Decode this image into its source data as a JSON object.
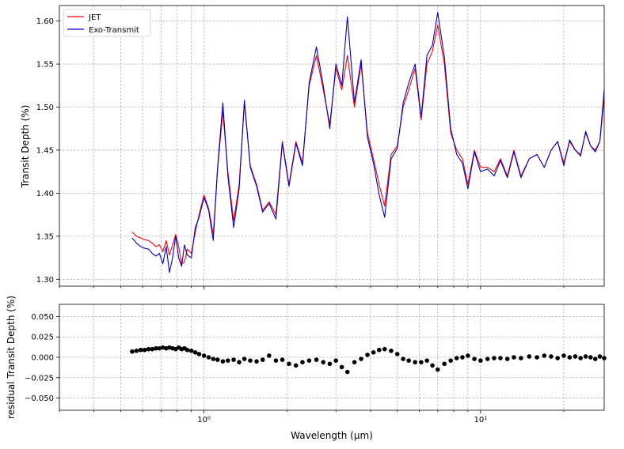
{
  "chart_data": [
    {
      "type": "line",
      "title": "",
      "xlabel": "",
      "ylabel": "Transit Depth (%)",
      "x_scale": "log",
      "xlim": [
        0.3,
        28
      ],
      "ylim": [
        1.292,
        1.618
      ],
      "yticks": [
        1.3,
        1.35,
        1.4,
        1.45,
        1.5,
        1.55,
        1.6
      ],
      "ytick_labels": [
        "1.30",
        "1.35",
        "1.40",
        "1.45",
        "1.50",
        "1.55",
        "1.60"
      ],
      "grid": true,
      "legend_position": "top-left",
      "colors": {
        "JET": "#ff0000",
        "Exo-Transmit": "#0000cc"
      },
      "x": [
        0.55,
        0.57,
        0.59,
        0.61,
        0.63,
        0.65,
        0.67,
        0.69,
        0.71,
        0.73,
        0.75,
        0.77,
        0.79,
        0.81,
        0.83,
        0.85,
        0.87,
        0.9,
        0.93,
        0.96,
        1.0,
        1.04,
        1.08,
        1.12,
        1.17,
        1.22,
        1.28,
        1.34,
        1.4,
        1.47,
        1.55,
        1.63,
        1.72,
        1.82,
        1.92,
        2.03,
        2.15,
        2.27,
        2.4,
        2.55,
        2.7,
        2.85,
        3.0,
        3.15,
        3.3,
        3.5,
        3.7,
        3.9,
        4.1,
        4.3,
        4.5,
        4.75,
        5.0,
        5.25,
        5.5,
        5.8,
        6.1,
        6.4,
        6.7,
        7.0,
        7.4,
        7.8,
        8.2,
        8.6,
        9.0,
        9.5,
        10.0,
        10.6,
        11.2,
        11.8,
        12.5,
        13.2,
        14.0,
        15.0,
        16.0,
        17.0,
        18.0,
        19.0,
        20.0,
        21.0,
        22.0,
        23.0,
        24.0,
        25.0,
        26.0,
        27.0,
        28.0
      ],
      "series": [
        {
          "name": "JET",
          "values": [
            1.355,
            1.35,
            1.348,
            1.346,
            1.345,
            1.342,
            1.338,
            1.34,
            1.332,
            1.345,
            1.328,
            1.34,
            1.352,
            1.338,
            1.318,
            1.32,
            1.335,
            1.33,
            1.355,
            1.375,
            1.398,
            1.382,
            1.352,
            1.428,
            1.495,
            1.425,
            1.368,
            1.41,
            1.505,
            1.432,
            1.41,
            1.38,
            1.39,
            1.375,
            1.46,
            1.41,
            1.46,
            1.435,
            1.525,
            1.56,
            1.52,
            1.48,
            1.545,
            1.52,
            1.56,
            1.5,
            1.55,
            1.47,
            1.44,
            1.41,
            1.385,
            1.445,
            1.455,
            1.5,
            1.52,
            1.545,
            1.485,
            1.55,
            1.565,
            1.595,
            1.55,
            1.47,
            1.45,
            1.44,
            1.41,
            1.45,
            1.43,
            1.43,
            1.425,
            1.44,
            1.42,
            1.45,
            1.42,
            1.44,
            1.445,
            1.43,
            1.45,
            1.46,
            1.435,
            1.46,
            1.45,
            1.445,
            1.47,
            1.455,
            1.45,
            1.46,
            1.51
          ]
        },
        {
          "name": "Exo-Transmit",
          "values": [
            1.348,
            1.342,
            1.338,
            1.336,
            1.335,
            1.33,
            1.327,
            1.33,
            1.318,
            1.338,
            1.308,
            1.325,
            1.35,
            1.325,
            1.315,
            1.34,
            1.328,
            1.325,
            1.36,
            1.372,
            1.395,
            1.38,
            1.345,
            1.43,
            1.505,
            1.42,
            1.36,
            1.405,
            1.508,
            1.43,
            1.408,
            1.378,
            1.388,
            1.37,
            1.458,
            1.408,
            1.458,
            1.432,
            1.528,
            1.57,
            1.525,
            1.475,
            1.55,
            1.525,
            1.605,
            1.505,
            1.555,
            1.465,
            1.435,
            1.398,
            1.372,
            1.44,
            1.452,
            1.505,
            1.528,
            1.55,
            1.488,
            1.56,
            1.572,
            1.61,
            1.558,
            1.475,
            1.445,
            1.435,
            1.405,
            1.448,
            1.425,
            1.428,
            1.42,
            1.438,
            1.418,
            1.448,
            1.418,
            1.44,
            1.445,
            1.43,
            1.45,
            1.46,
            1.432,
            1.462,
            1.45,
            1.443,
            1.472,
            1.455,
            1.448,
            1.46,
            1.52
          ]
        }
      ]
    },
    {
      "type": "scatter",
      "title": "",
      "xlabel": "Wavelength (μm)",
      "ylabel": "residual Transit Depth (%)",
      "x_scale": "log",
      "xlim": [
        0.3,
        28
      ],
      "ylim": [
        -0.065,
        0.065
      ],
      "yticks": [
        -0.05,
        -0.025,
        0.0,
        0.025,
        0.05
      ],
      "ytick_labels": [
        "−0.050",
        "−0.025",
        "0.000",
        "0.025",
        "0.050"
      ],
      "xticks": [
        1,
        10
      ],
      "xtick_labels": [
        "10⁰",
        "10¹"
      ],
      "grid": true,
      "colors": {
        "markers": "#000000"
      },
      "x": [
        0.55,
        0.57,
        0.59,
        0.61,
        0.63,
        0.65,
        0.67,
        0.69,
        0.71,
        0.73,
        0.75,
        0.77,
        0.79,
        0.81,
        0.83,
        0.85,
        0.87,
        0.9,
        0.93,
        0.96,
        1.0,
        1.04,
        1.08,
        1.12,
        1.17,
        1.22,
        1.28,
        1.34,
        1.4,
        1.47,
        1.55,
        1.63,
        1.72,
        1.82,
        1.92,
        2.03,
        2.15,
        2.27,
        2.4,
        2.55,
        2.7,
        2.85,
        3.0,
        3.15,
        3.3,
        3.5,
        3.7,
        3.9,
        4.1,
        4.3,
        4.5,
        4.75,
        5.0,
        5.25,
        5.5,
        5.8,
        6.1,
        6.4,
        6.7,
        7.0,
        7.4,
        7.8,
        8.2,
        8.6,
        9.0,
        9.5,
        10.0,
        10.6,
        11.2,
        11.8,
        12.5,
        13.2,
        14.0,
        15.0,
        16.0,
        17.0,
        18.0,
        19.0,
        20.0,
        21.0,
        22.0,
        23.0,
        24.0,
        25.0,
        26.0,
        27.0,
        28.0
      ],
      "values": [
        0.007,
        0.008,
        0.009,
        0.009,
        0.01,
        0.01,
        0.011,
        0.011,
        0.012,
        0.011,
        0.012,
        0.011,
        0.01,
        0.012,
        0.01,
        0.011,
        0.009,
        0.008,
        0.006,
        0.004,
        0.002,
        0.0,
        -0.002,
        -0.003,
        -0.005,
        -0.004,
        -0.003,
        -0.006,
        -0.002,
        -0.004,
        -0.005,
        -0.003,
        0.002,
        -0.004,
        -0.003,
        -0.008,
        -0.01,
        -0.006,
        -0.004,
        -0.003,
        -0.006,
        -0.008,
        -0.004,
        -0.012,
        -0.018,
        -0.006,
        -0.002,
        0.003,
        0.006,
        0.009,
        0.01,
        0.008,
        0.004,
        -0.002,
        -0.004,
        -0.006,
        -0.006,
        -0.004,
        -0.01,
        -0.015,
        -0.008,
        -0.004,
        -0.001,
        0.0,
        0.002,
        -0.002,
        -0.004,
        -0.002,
        -0.001,
        -0.001,
        -0.002,
        0.0,
        -0.001,
        0.001,
        0.0,
        0.002,
        0.001,
        -0.001,
        0.002,
        0.0,
        0.001,
        -0.001,
        0.001,
        0.0,
        -0.002,
        0.001,
        -0.001
      ]
    }
  ]
}
